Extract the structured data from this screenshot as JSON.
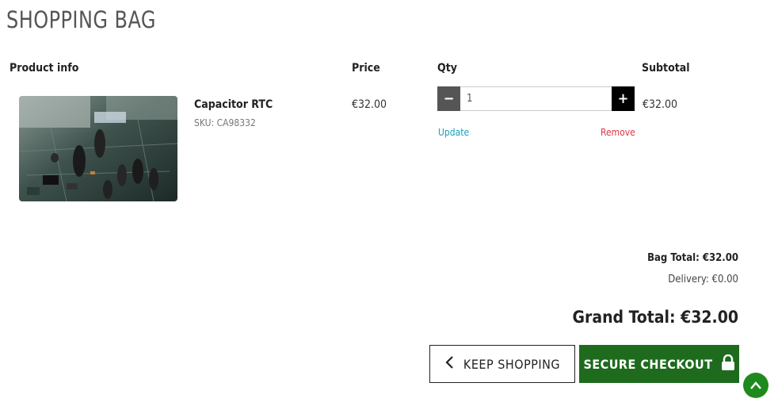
{
  "page": {
    "title": "SHOPPING BAG"
  },
  "table": {
    "headers": {
      "product": "Product info",
      "price": "Price",
      "qty": "Qty",
      "subtotal": "Subtotal"
    }
  },
  "items": [
    {
      "name": "Capacitor RTC",
      "sku": "SKU: CA98332",
      "price": "€32.00",
      "qty": "1",
      "subtotal": "€32.00",
      "update_label": "Update",
      "remove_label": "Remove",
      "image_icon": "circuit-board-photo"
    }
  ],
  "totals": {
    "bag_total": "Bag Total: €32.00",
    "delivery": "Delivery: €0.00",
    "grand_total": "Grand Total: €32.00"
  },
  "actions": {
    "keep_shopping": "KEEP SHOPPING",
    "secure_checkout": "SECURE CHECKOUT",
    "qty_minus": "−",
    "qty_plus": "+"
  },
  "colors": {
    "checkout": "#1e6b1e",
    "back_to_top": "#1e8a1e",
    "update_link": "#17a2b8",
    "remove_link": "#dc3545"
  },
  "icons": {
    "keep_shopping": "chevron-left-icon",
    "checkout": "lock-icon",
    "back_to_top": "chevron-up-icon"
  }
}
